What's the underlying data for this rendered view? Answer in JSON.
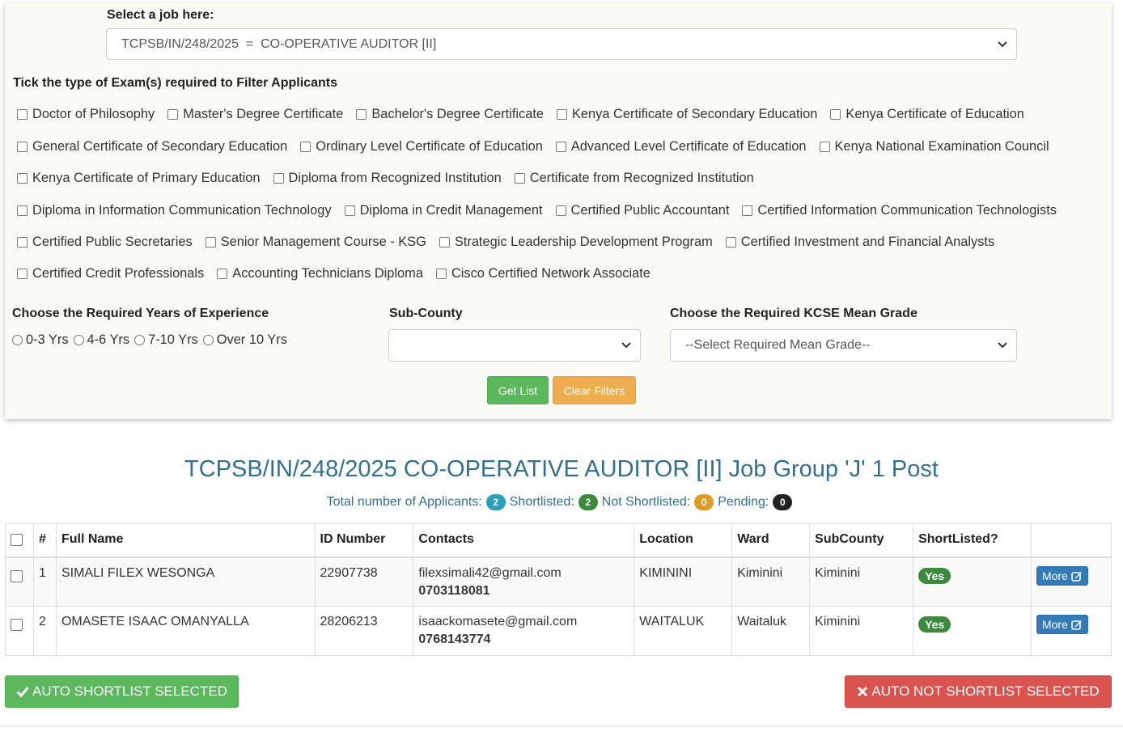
{
  "filters": {
    "job_label": "Select a job here:",
    "job_selected": "TCPSB/IN/248/2025  =  CO-OPERATIVE AUDITOR [II]",
    "exam_label": "Tick the type of Exam(s) required to Filter Applicants",
    "exam_rows": [
      [
        "Doctor of Philosophy",
        "Master's Degree Certificate",
        "Bachelor's Degree Certificate",
        "Kenya Certificate of Secondary Education",
        "Kenya Certificate of Education"
      ],
      [
        "General Certificate of Secondary Education",
        "Ordinary Level Certificate of Education",
        "Advanced Level Certificate of Education",
        "Kenya National Examination Council"
      ],
      [
        "Kenya Certificate of Primary Education",
        "Diploma from Recognized Institution",
        "Certificate from Recognized Institution"
      ],
      [
        "Diploma in Information Communication Technology",
        "Diploma in Credit Management",
        "Certified Public Accountant",
        "Certified Information Communication Technologists"
      ],
      [
        "Certified Public Secretaries",
        "Senior Management Course - KSG",
        "Strategic Leadership Development Program",
        "Certified Investment and Financial Analysts"
      ],
      [
        "Certified Credit Professionals",
        "Accounting Technicians Diploma",
        "Cisco Certified Network Associate"
      ]
    ],
    "experience_label": "Choose the Required Years of Experience",
    "experience_options": [
      "0-3 Yrs",
      "4-6 Yrs",
      "7-10 Yrs",
      "Over 10 Yrs"
    ],
    "subcounty_label": "Sub-County",
    "subcounty_value": "",
    "grade_label": "Choose the Required KCSE Mean Grade",
    "grade_value": "--Select Required Mean Grade--",
    "get_list_label": "Get List",
    "clear_label": "Clear Filters"
  },
  "results": {
    "title": "TCPSB/IN/248/2025 CO-OPERATIVE AUDITOR [II] Job Group 'J' 1 Post",
    "total_label": "Total number of Applicants:",
    "total": "2",
    "shortlisted_label": "Shortlisted:",
    "shortlisted": "2",
    "not_shortlisted_label": "Not Shortlisted:",
    "not_shortlisted": "0",
    "pending_label": "Pending:",
    "pending": "0",
    "colors": {
      "info": "#2a9fbc",
      "success": "#3c8b3c",
      "warning": "#e09a26",
      "dark": "#222222"
    }
  },
  "table": {
    "headers": [
      "#",
      "Full Name",
      "ID Number",
      "Contacts",
      "Location",
      "Ward",
      "SubCounty",
      "ShortListed?"
    ],
    "rows": [
      {
        "num": "1",
        "name": "SIMALI FILEX WESONGA",
        "id": "22907738",
        "email": "filexsimali42@gmail.com",
        "phone": "0703118081",
        "location": "KIMININI",
        "ward": "Kiminini",
        "subcounty": "Kiminini",
        "shortlisted": "Yes",
        "more": "More"
      },
      {
        "num": "2",
        "name": "OMASETE ISAAC OMANYALLA",
        "id": "28206213",
        "email": "isaackomasete@gmail.com",
        "phone": "0768143774",
        "location": "WAITALUK",
        "ward": "Waitaluk",
        "subcounty": "Kiminini",
        "shortlisted": "Yes",
        "more": "More"
      }
    ]
  },
  "actions": {
    "auto_shortlist": "AUTO SHORTLIST SELECTED",
    "auto_not_shortlist": "AUTO NOT SHORTLIST SELECTED"
  },
  "icons": {
    "check": "check-icon",
    "times": "times-icon",
    "edit": "edit-icon",
    "chevron": "chevron-down-icon"
  }
}
